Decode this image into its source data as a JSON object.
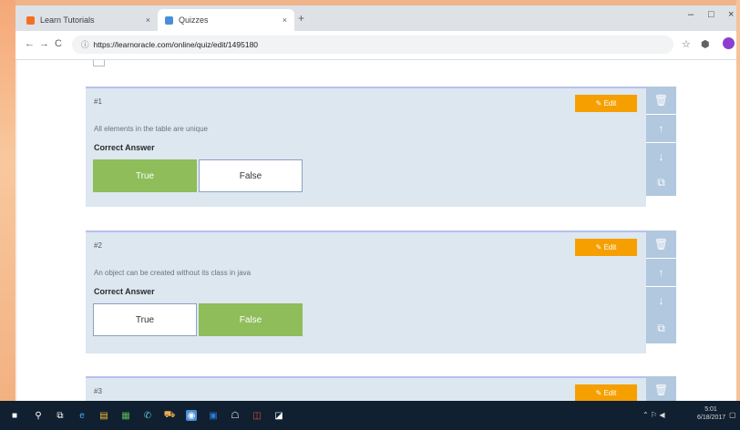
{
  "browser": {
    "tabs": [
      {
        "label": "Learn Tutorials",
        "favicon": "orange-favicon",
        "close": "×"
      },
      {
        "label": "Quizzes",
        "favicon": "quiz-favicon",
        "close": "×"
      }
    ],
    "new_tab": "+",
    "window_controls": {
      "minimize": "–",
      "maximize": "□",
      "close": "×"
    },
    "nav": {
      "back": "←",
      "forward": "→",
      "reload": "C",
      "info": "ⓘ"
    },
    "url": "https://learnoracle.com/online/quiz/edit/1495180",
    "star": "☆",
    "ext": "⬢"
  },
  "questions": [
    {
      "number": "#1",
      "edit_label": "✎ Edit",
      "text": "All elements in the table are unique",
      "correct_label": "Correct Answer",
      "answers": [
        {
          "label": "True",
          "selected": true
        },
        {
          "label": "False",
          "selected": false
        }
      ]
    },
    {
      "number": "#2",
      "edit_label": "✎ Edit",
      "text": "An object can be created without its class in java",
      "correct_label": "Correct Answer",
      "answers": [
        {
          "label": "True",
          "selected": false
        },
        {
          "label": "False",
          "selected": true
        }
      ]
    },
    {
      "number": "#3",
      "edit_label": "✎ Edit"
    }
  ],
  "side_actions": {
    "delete": "🗑",
    "up": "↑",
    "down": "↓",
    "copy": "⧉"
  },
  "taskbar": {
    "start": "■",
    "search": "⚲",
    "taskview": "⧉",
    "apps": [
      "e",
      "▤",
      "▦",
      "✆",
      "⛟",
      "◉",
      "▣",
      "☖",
      "◫",
      "◪"
    ],
    "tray": "⌃ ⚐ ◀",
    "time": "5:01",
    "date": "6/18/2017",
    "notify": "▢"
  }
}
